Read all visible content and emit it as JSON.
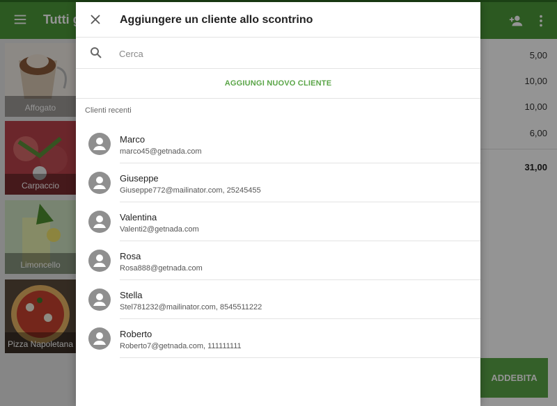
{
  "app": {
    "title": "Tutti g",
    "tiles": [
      {
        "label": "Affogato"
      },
      {
        "label": "Carpaccio"
      },
      {
        "label": "Limoncello"
      },
      {
        "label": "Pizza Napoletana"
      }
    ],
    "ticket": {
      "values": [
        "5,00",
        "10,00",
        "10,00",
        "6,00"
      ],
      "total": "31,00",
      "charge_label": "ADDEBITA"
    }
  },
  "dialog": {
    "title": "Aggiungere un cliente allo scontrino",
    "search": {
      "placeholder": "Cerca",
      "value": ""
    },
    "add_new_label": "AGGIUNGI NUOVO CLIENTE",
    "recent_label": "Clienti recenti",
    "clients": [
      {
        "name": "Marco",
        "detail": "marco45@getnada.com"
      },
      {
        "name": "Giuseppe",
        "detail": "Giuseppe772@mailinator.com, 25245455"
      },
      {
        "name": "Valentina",
        "detail": "Valenti2@getnada.com"
      },
      {
        "name": "Rosa",
        "detail": "Rosa888@getnada.com"
      },
      {
        "name": "Stella",
        "detail": "Stel781232@mailinator.com, 8545511222"
      },
      {
        "name": "Roberto",
        "detail": "Roberto7@getnada.com, 111111111"
      }
    ]
  },
  "colors": {
    "brand_green": "#4d9a3a",
    "accent_green": "#5aa547"
  },
  "icons": {
    "menu": "menu-icon",
    "add_person": "person-add-icon",
    "more": "more-vert-icon",
    "close": "close-icon",
    "search": "search-icon",
    "avatar": "account-circle-icon"
  }
}
